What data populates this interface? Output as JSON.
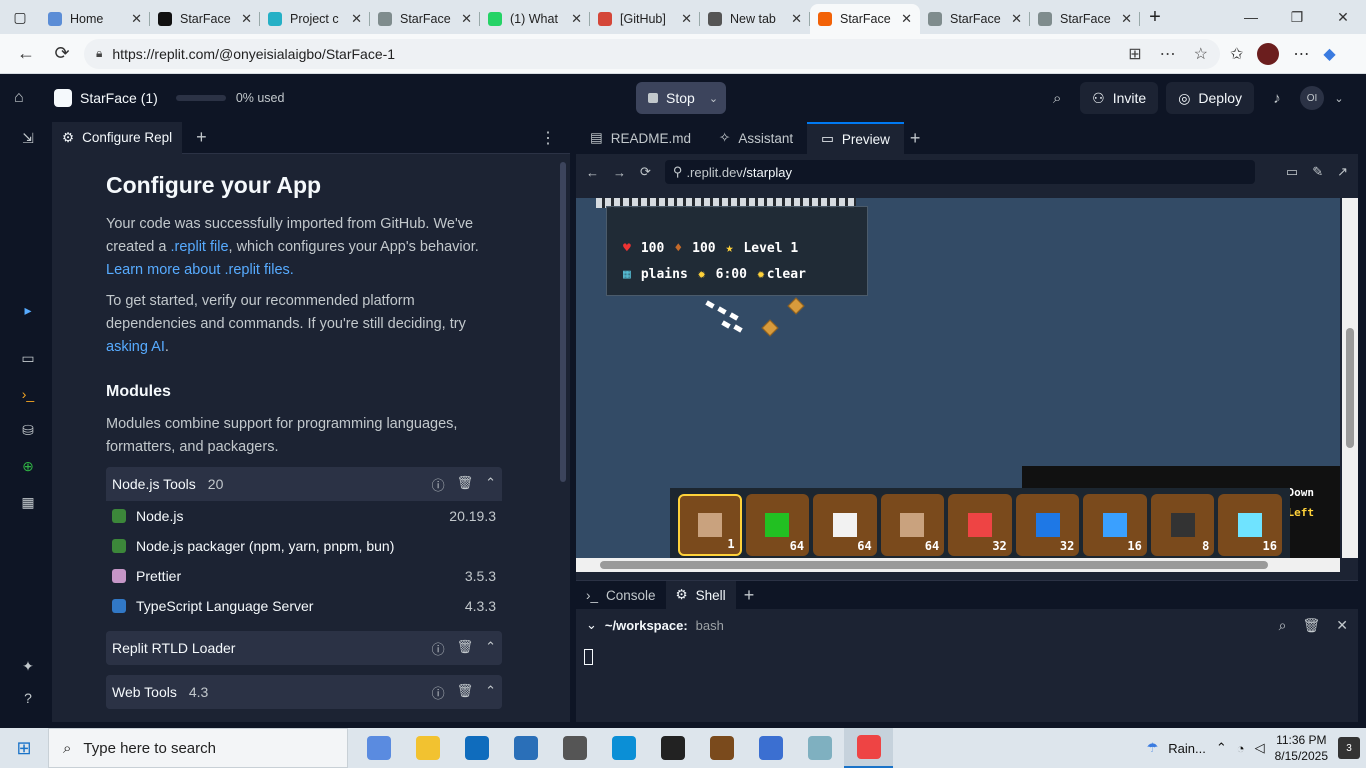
{
  "browser": {
    "tabs": [
      {
        "label": "Home",
        "color": "#5b8dd6"
      },
      {
        "label": "StarFace",
        "color": "#111111"
      },
      {
        "label": "Project c",
        "color": "#25b0c6"
      },
      {
        "label": "StarFace",
        "color": "#7f8c8d"
      },
      {
        "label": "(1) What",
        "color": "#25d366"
      },
      {
        "label": "[GitHub]",
        "color": "#d44638"
      },
      {
        "label": "New tab",
        "color": "#555555"
      },
      {
        "label": "StarFace",
        "color": "#f26207",
        "active": true
      },
      {
        "label": "StarFace",
        "color": "#7f8c8d"
      },
      {
        "label": "StarFace",
        "color": "#7f8c8d"
      }
    ],
    "url": "https://replit.com/@onyeisialaigbo/StarFace-1"
  },
  "replit": {
    "project_name": "StarFace (1)",
    "usage": "0% used",
    "stop_label": "Stop",
    "invite_label": "Invite",
    "deploy_label": "Deploy",
    "avatar_initials": "OI"
  },
  "left_pane": {
    "tab_label": "Configure Repl",
    "title": "Configure your App",
    "para1_a": "Your code was successfully imported from GitHub. We've created a ",
    "para1_link": ".replit file",
    "para1_b": ", which configures your App's behavior.",
    "para1_link2": "Learn more about .replit files.",
    "para2_a": "To get started, verify our recommended platform dependencies and commands. If you're still deciding, try ",
    "para2_link": "asking AI",
    "para2_b": ".",
    "modules_title": "Modules",
    "modules_desc": "Modules combine support for programming languages, formatters, and packagers.",
    "modules": [
      {
        "name": "Node.js Tools",
        "version": "20"
      },
      {
        "name": "Replit RTLD Loader",
        "version": ""
      },
      {
        "name": "Web Tools",
        "version": "4.3"
      }
    ],
    "node_items": [
      {
        "name": "Node.js",
        "version": "20.19.3",
        "icon": "nodejs-icon",
        "color": "#3c873a"
      },
      {
        "name": "Node.js packager (npm, yarn, pnpm, bun)",
        "version": "",
        "icon": "nodejs-icon",
        "color": "#3c873a"
      },
      {
        "name": "Prettier",
        "version": "3.5.3",
        "icon": "prettier-icon",
        "color": "#c596c7"
      },
      {
        "name": "TypeScript Language Server",
        "version": "4.3.3",
        "icon": "typescript-icon",
        "color": "#3178c6"
      }
    ]
  },
  "right_pane": {
    "tabs": [
      "README.md",
      "Assistant",
      "Preview"
    ],
    "preview_url_prefix": ".replit.dev",
    "preview_url_path": "/starplay",
    "hud": {
      "health": "100",
      "food": "100",
      "level": "Level 1",
      "biome": "plains",
      "time": "6:00",
      "weather": "clear"
    },
    "hotbar": [
      {
        "count": "1",
        "color": "#c9a27e"
      },
      {
        "count": "64",
        "color": "#22c022"
      },
      {
        "count": "64",
        "color": "#f2f2f2"
      },
      {
        "count": "64",
        "color": "#c9a27e"
      },
      {
        "count": "32",
        "color": "#e44"
      },
      {
        "count": "32",
        "color": "#1e78e6"
      },
      {
        "count": "16",
        "color": "#3aa0ff"
      },
      {
        "count": "8",
        "color": "#333333"
      },
      {
        "count": "16",
        "color": "#6fe3ff"
      }
    ],
    "hint_line1": "Down",
    "hint_line2": "Left",
    "console_tab": "Console",
    "shell_tab": "Shell",
    "shell_dir": "~/workspace",
    "shell_name": "bash"
  },
  "taskbar": {
    "search_placeholder": "Type here to search",
    "weather": "Rain...",
    "time": "11:36 PM",
    "date": "8/15/2025",
    "notifications": "3",
    "apps": [
      "#5a8be0",
      "#f2c230",
      "#0f6cbd",
      "#2a6fb8",
      "#555",
      "#0b8fd6",
      "#222",
      "#7a4a1c",
      "#3b6fd1",
      "#7fb0c0",
      "#e44"
    ]
  }
}
